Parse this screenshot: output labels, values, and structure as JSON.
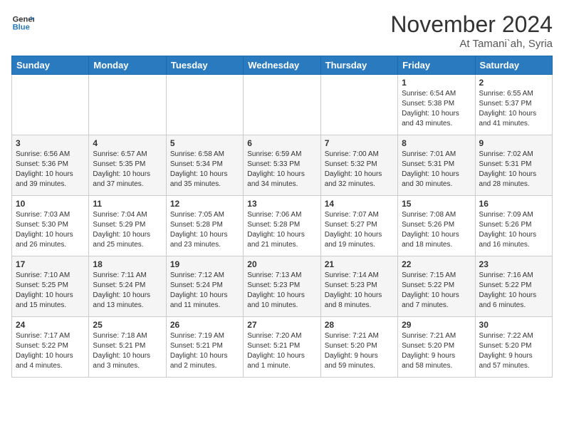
{
  "logo": {
    "line1": "General",
    "line2": "Blue"
  },
  "title": "November 2024",
  "location": "At Tamani`ah, Syria",
  "days_header": [
    "Sunday",
    "Monday",
    "Tuesday",
    "Wednesday",
    "Thursday",
    "Friday",
    "Saturday"
  ],
  "weeks": [
    [
      {
        "day": "",
        "info": ""
      },
      {
        "day": "",
        "info": ""
      },
      {
        "day": "",
        "info": ""
      },
      {
        "day": "",
        "info": ""
      },
      {
        "day": "",
        "info": ""
      },
      {
        "day": "1",
        "info": "Sunrise: 6:54 AM\nSunset: 5:38 PM\nDaylight: 10 hours\nand 43 minutes."
      },
      {
        "day": "2",
        "info": "Sunrise: 6:55 AM\nSunset: 5:37 PM\nDaylight: 10 hours\nand 41 minutes."
      }
    ],
    [
      {
        "day": "3",
        "info": "Sunrise: 6:56 AM\nSunset: 5:36 PM\nDaylight: 10 hours\nand 39 minutes."
      },
      {
        "day": "4",
        "info": "Sunrise: 6:57 AM\nSunset: 5:35 PM\nDaylight: 10 hours\nand 37 minutes."
      },
      {
        "day": "5",
        "info": "Sunrise: 6:58 AM\nSunset: 5:34 PM\nDaylight: 10 hours\nand 35 minutes."
      },
      {
        "day": "6",
        "info": "Sunrise: 6:59 AM\nSunset: 5:33 PM\nDaylight: 10 hours\nand 34 minutes."
      },
      {
        "day": "7",
        "info": "Sunrise: 7:00 AM\nSunset: 5:32 PM\nDaylight: 10 hours\nand 32 minutes."
      },
      {
        "day": "8",
        "info": "Sunrise: 7:01 AM\nSunset: 5:31 PM\nDaylight: 10 hours\nand 30 minutes."
      },
      {
        "day": "9",
        "info": "Sunrise: 7:02 AM\nSunset: 5:31 PM\nDaylight: 10 hours\nand 28 minutes."
      }
    ],
    [
      {
        "day": "10",
        "info": "Sunrise: 7:03 AM\nSunset: 5:30 PM\nDaylight: 10 hours\nand 26 minutes."
      },
      {
        "day": "11",
        "info": "Sunrise: 7:04 AM\nSunset: 5:29 PM\nDaylight: 10 hours\nand 25 minutes."
      },
      {
        "day": "12",
        "info": "Sunrise: 7:05 AM\nSunset: 5:28 PM\nDaylight: 10 hours\nand 23 minutes."
      },
      {
        "day": "13",
        "info": "Sunrise: 7:06 AM\nSunset: 5:28 PM\nDaylight: 10 hours\nand 21 minutes."
      },
      {
        "day": "14",
        "info": "Sunrise: 7:07 AM\nSunset: 5:27 PM\nDaylight: 10 hours\nand 19 minutes."
      },
      {
        "day": "15",
        "info": "Sunrise: 7:08 AM\nSunset: 5:26 PM\nDaylight: 10 hours\nand 18 minutes."
      },
      {
        "day": "16",
        "info": "Sunrise: 7:09 AM\nSunset: 5:26 PM\nDaylight: 10 hours\nand 16 minutes."
      }
    ],
    [
      {
        "day": "17",
        "info": "Sunrise: 7:10 AM\nSunset: 5:25 PM\nDaylight: 10 hours\nand 15 minutes."
      },
      {
        "day": "18",
        "info": "Sunrise: 7:11 AM\nSunset: 5:24 PM\nDaylight: 10 hours\nand 13 minutes."
      },
      {
        "day": "19",
        "info": "Sunrise: 7:12 AM\nSunset: 5:24 PM\nDaylight: 10 hours\nand 11 minutes."
      },
      {
        "day": "20",
        "info": "Sunrise: 7:13 AM\nSunset: 5:23 PM\nDaylight: 10 hours\nand 10 minutes."
      },
      {
        "day": "21",
        "info": "Sunrise: 7:14 AM\nSunset: 5:23 PM\nDaylight: 10 hours\nand 8 minutes."
      },
      {
        "day": "22",
        "info": "Sunrise: 7:15 AM\nSunset: 5:22 PM\nDaylight: 10 hours\nand 7 minutes."
      },
      {
        "day": "23",
        "info": "Sunrise: 7:16 AM\nSunset: 5:22 PM\nDaylight: 10 hours\nand 6 minutes."
      }
    ],
    [
      {
        "day": "24",
        "info": "Sunrise: 7:17 AM\nSunset: 5:22 PM\nDaylight: 10 hours\nand 4 minutes."
      },
      {
        "day": "25",
        "info": "Sunrise: 7:18 AM\nSunset: 5:21 PM\nDaylight: 10 hours\nand 3 minutes."
      },
      {
        "day": "26",
        "info": "Sunrise: 7:19 AM\nSunset: 5:21 PM\nDaylight: 10 hours\nand 2 minutes."
      },
      {
        "day": "27",
        "info": "Sunrise: 7:20 AM\nSunset: 5:21 PM\nDaylight: 10 hours\nand 1 minute."
      },
      {
        "day": "28",
        "info": "Sunrise: 7:21 AM\nSunset: 5:20 PM\nDaylight: 9 hours\nand 59 minutes."
      },
      {
        "day": "29",
        "info": "Sunrise: 7:21 AM\nSunset: 5:20 PM\nDaylight: 9 hours\nand 58 minutes."
      },
      {
        "day": "30",
        "info": "Sunrise: 7:22 AM\nSunset: 5:20 PM\nDaylight: 9 hours\nand 57 minutes."
      }
    ]
  ]
}
